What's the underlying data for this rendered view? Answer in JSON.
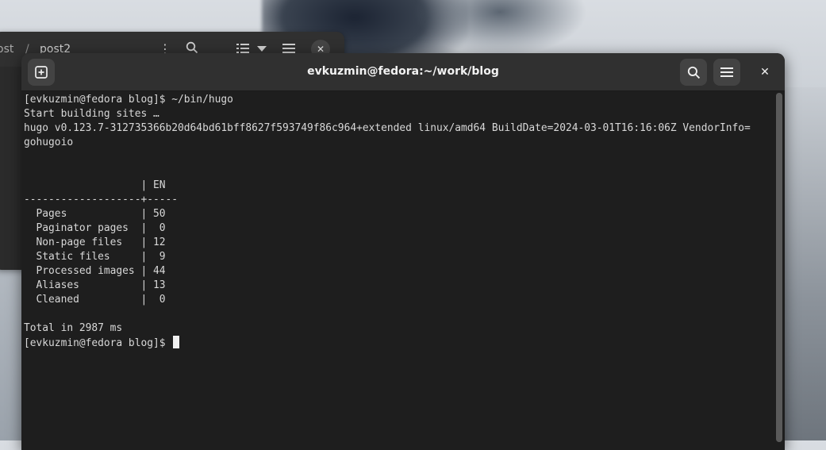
{
  "background_window": {
    "breadcrumb_prev": "ost",
    "breadcrumb_separator": "/",
    "breadcrumb_current": "post2",
    "kebab": "⋮",
    "close": "✕"
  },
  "terminal": {
    "title": "evkuzmin@fedora:~/work/blog",
    "close": "✕",
    "lines": [
      "[evkuzmin@fedora blog]$ ~/bin/hugo",
      "Start building sites …",
      "hugo v0.123.7-312735366b20d64bd61bff8627f593749f86c964+extended linux/amd64 BuildDate=2024-03-01T16:16:06Z VendorInfo=",
      "gohugoio",
      "",
      "",
      "                   | EN",
      "-------------------+-----",
      "  Pages            | 50",
      "  Paginator pages  |  0",
      "  Non-page files   | 12",
      "  Static files     |  9",
      "  Processed images | 44",
      "  Aliases          | 13",
      "  Cleaned          |  0",
      "",
      "Total in 2987 ms"
    ],
    "prompt": "[evkuzmin@fedora blog]$ "
  },
  "icons": {
    "new_tab": "new-tab-icon",
    "search": "search-icon",
    "menu": "hamburger-menu-icon",
    "close": "close-icon"
  },
  "colors": {
    "terminal_bg": "#1e1e1e",
    "header_bg": "#303030",
    "text": "#d8d8d8"
  }
}
